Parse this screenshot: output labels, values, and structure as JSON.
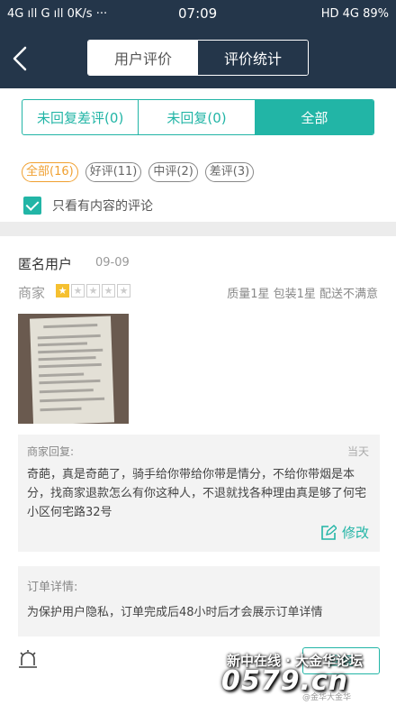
{
  "status_bar": {
    "left": "4G ıll  G ıll  0K/s ···",
    "time": "07:09",
    "right": "HD 4G  89%"
  },
  "nav": {
    "back_icon": "chevron-left-icon",
    "tabs": [
      "用户评价",
      "评价统计"
    ],
    "active_tab": 0
  },
  "filter": {
    "buttons": [
      "未回复差评(0)",
      "未回复(0)",
      "全部"
    ],
    "active_button": 2,
    "chips": [
      "全部(16)",
      "好评(11)",
      "中评(2)",
      "差评(3)"
    ],
    "active_chip": 0,
    "checkbox_label": "只看有内容的评论",
    "checkbox_checked": true
  },
  "review": {
    "user": "匿名用户",
    "date": "09-09",
    "merchant_label": "商家",
    "stars": 1,
    "stars_max": 5,
    "ratings": "质量1星 包装1星 配送不满意",
    "merchant_reply": {
      "label": "商家回复:",
      "date": "当天",
      "text": "奇葩，真是奇葩了，骑手给你带给你带是情分，不给你带烟是本分，找商家退款怎么有你这种人，不退就找各种理由真是够了何宅小区何宅路32号",
      "edit_label": "修改"
    },
    "order": {
      "label": "订单详情:",
      "text": "为保护用户隐私，订单完成后48小时后才会展示订单详情"
    },
    "reply_button": "回复"
  },
  "watermark": {
    "line1": "新中在线 · 大金华论坛",
    "line2": "0579.cn",
    "line3": "@金华大金华"
  },
  "colors": {
    "header_bg": "#24364a",
    "accent": "#22b5a6",
    "chip_active": "#f0a030",
    "star": "#f5c030"
  }
}
